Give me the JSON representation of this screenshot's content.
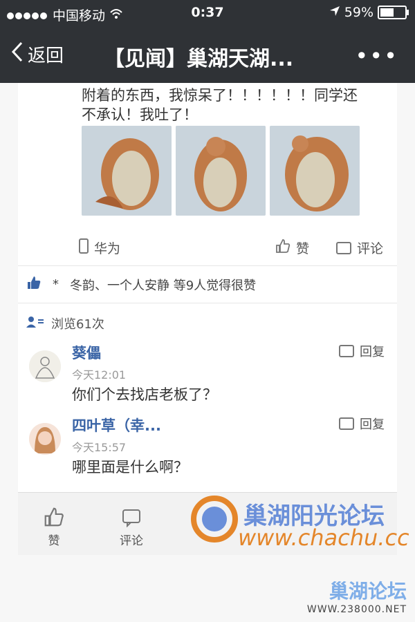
{
  "status_bar": {
    "carrier": "中国移动",
    "time": "0:37",
    "battery_percent_text": "59%",
    "battery_level": 0.59
  },
  "nav": {
    "back_label": "返回",
    "title": "【见闻】巢湖天湖...",
    "more": "•••"
  },
  "post": {
    "text_line1": "附着的东西，我惊呆了！！！！！！同学还",
    "text_line2": "不承认！我吐了！",
    "device": "华为",
    "like_label": "赞",
    "comment_label": "评论"
  },
  "likes": {
    "text": "冬韵、一个人安静 等9人觉得很赞",
    "star": "*"
  },
  "views": {
    "text": "浏览61次"
  },
  "comments": [
    {
      "name": "葵儡",
      "time": "今天12:01",
      "text": "你们个去找店老板了？",
      "reply_label": "回复"
    },
    {
      "name": "四叶草（幸...",
      "time": "今天15:57",
      "text": "哪里面是什么啊？",
      "reply_label": "回复"
    }
  ],
  "bottom_bar": {
    "like_label": "赞",
    "comment_label": "评论"
  },
  "watermarks": {
    "forum_name": "巢湖阳光论坛",
    "forum_url": "www.chachu.cc",
    "corner_name": "巢湖论坛",
    "corner_url": "WWW.238000.NET"
  },
  "colors": {
    "nav_bg": "#2f3236",
    "name_blue": "#3a64a6"
  }
}
